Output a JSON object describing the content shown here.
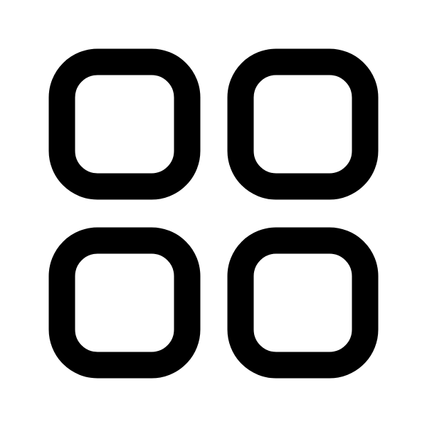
{
  "icon": {
    "name": "grid-icon",
    "description_label": "",
    "stroke_color": "#000000",
    "background_color": "#ffffff",
    "tiles": [
      "top-left",
      "top-right",
      "bottom-left",
      "bottom-right"
    ]
  }
}
